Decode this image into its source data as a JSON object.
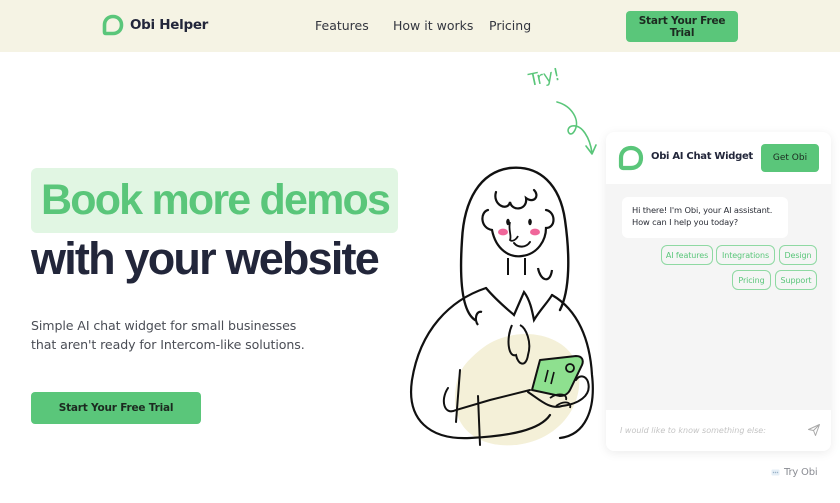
{
  "header": {
    "brand": "Obi Helper",
    "nav": [
      "Features",
      "How it works",
      "Pricing"
    ],
    "cta_label": "Start Your Free Trial"
  },
  "hero": {
    "headline_highlight": "Book more demos",
    "headline_rest": "with your website",
    "subtext": "Simple AI chat widget for small businesses that aren't ready for Intercom-like solutions.",
    "cta_label": "Start Your Free Trial",
    "annotation": "Try!"
  },
  "chat_widget": {
    "title": "Obi AI Chat Widget",
    "get_button": "Get Obi",
    "greeting_line1": "Hi there! I'm Obi, your AI assistant.",
    "greeting_line2": "How can I help you today?",
    "chips": [
      "AI features",
      "Integrations",
      "Design",
      "Pricing",
      "Support"
    ],
    "input_placeholder": "I would like to know something else:",
    "launcher_label": "Try Obi"
  },
  "colors": {
    "brand_green": "#5ac67a",
    "highlight_bg": "#e1f6e3",
    "header_bg": "#f5f3e4",
    "dark_text": "#22263a"
  }
}
